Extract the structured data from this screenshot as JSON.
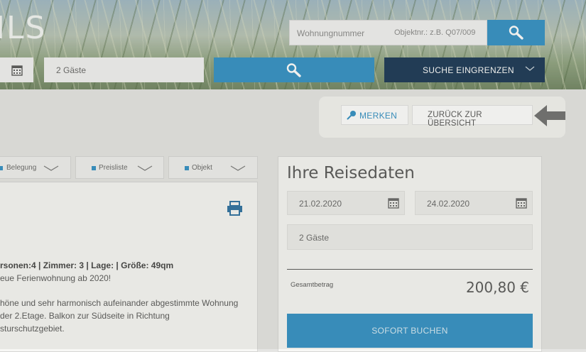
{
  "hero": {
    "title_fragment": "ILS"
  },
  "search": {
    "apartment_number_label": "Wohnungnummer",
    "object_number_placeholder": "Objektnr.: z.B. Q07/009",
    "guests_value": "2 Gäste",
    "refine_label": "SUCHE EINGRENZEN"
  },
  "actions": {
    "merken_label": "MERKEN",
    "back_label": "ZURÜCK ZUR ÜBERSICHT"
  },
  "tabs": [
    {
      "label": "Belegung"
    },
    {
      "label": "Preisliste"
    },
    {
      "label": "Objekt"
    }
  ],
  "description": {
    "facts": "rsonen:4 | Zimmer: 3 | Lage: | Größe: 49qm",
    "line1": "eue Ferienwohnung ab 2020!",
    "line2": "höne und sehr harmonisch aufeinander abgestimmte Wohnung",
    "line3": "der 2.Etage. Balkon zur Südseite in Richtung",
    "line4": "sturschutzgebiet."
  },
  "travel": {
    "title": "Ihre Reisedaten",
    "arrival": "21.02.2020",
    "departure": "24.02.2020",
    "guests": "2 Gäste",
    "total_label": "Gesamtbetrag",
    "total_value": "200,80 €",
    "book_label": "SOFORT BUCHEN"
  },
  "colors": {
    "accent": "#2f8fc4",
    "navy": "#163452"
  },
  "icons": [
    "search-icon",
    "calendar-icon",
    "chevron-down-icon",
    "pin-icon",
    "arrow-left-icon",
    "print-icon"
  ]
}
